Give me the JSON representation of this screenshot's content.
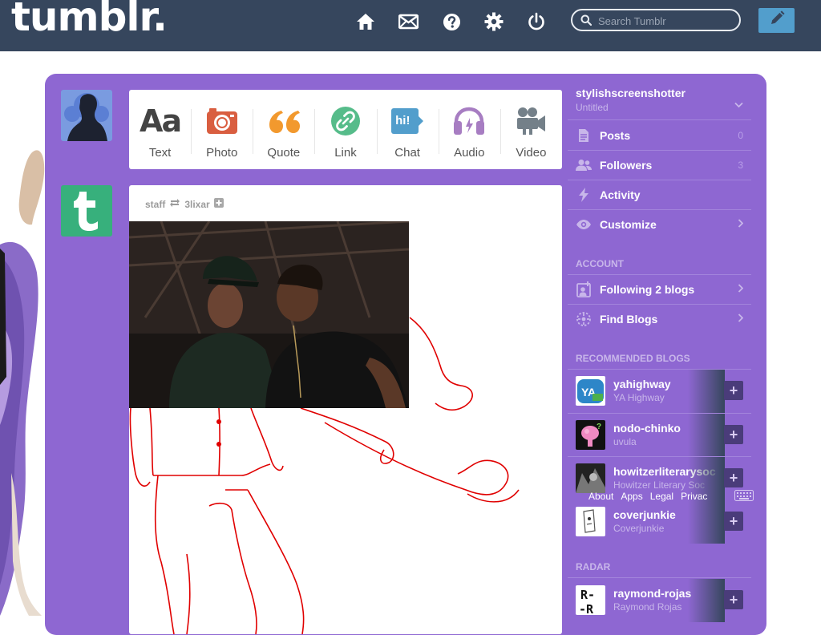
{
  "header": {
    "logo": "tumblr.",
    "search_placeholder": "Search Tumblr",
    "nav": [
      "home-icon",
      "mail-icon",
      "help-icon",
      "gear-icon",
      "power-icon"
    ]
  },
  "post_types": [
    {
      "label": "Text",
      "icon": "text-aa-icon",
      "glyph": "Aa",
      "color": "#444444"
    },
    {
      "label": "Photo",
      "icon": "camera-icon",
      "color": "#d95e40"
    },
    {
      "label": "Quote",
      "icon": "quote-icon",
      "glyph": "66",
      "color": "#f2992e"
    },
    {
      "label": "Link",
      "icon": "link-icon",
      "color": "#56bc8a"
    },
    {
      "label": "Chat",
      "icon": "chat-icon",
      "glyph": "hi!",
      "color": "#529ecc"
    },
    {
      "label": "Audio",
      "icon": "headphones-icon",
      "color": "#a77dc2"
    },
    {
      "label": "Video",
      "icon": "video-camera-icon",
      "color": "#748089"
    }
  ],
  "post": {
    "author": "staff",
    "reblogged_from": "3lixar",
    "photo_colors": {
      "wall": "#2b2320",
      "shirt_left": "#1d2a22",
      "shirt_right": "#121212",
      "skin": "#6b4433"
    },
    "drawing_color": "#e00000"
  },
  "sidebar": {
    "blog_name": "stylishscreenshotter",
    "blog_subtitle": "Untitled",
    "items": [
      {
        "label": "Posts",
        "count": "0",
        "icon": "document-icon"
      },
      {
        "label": "Followers",
        "count": "3",
        "icon": "people-icon"
      },
      {
        "label": "Activity",
        "count": "",
        "icon": "lightning-icon"
      },
      {
        "label": "Customize",
        "count": "",
        "icon": "eye-icon"
      }
    ],
    "account_title": "ACCOUNT",
    "account_items": [
      {
        "label": "Following 2 blogs",
        "icon": "add-person-icon"
      },
      {
        "label": "Find Blogs",
        "icon": "compass-icon"
      }
    ],
    "recommended_title": "RECOMMENDED BLOGS",
    "recommended": [
      {
        "name": "yahighway",
        "subtitle": "YA Highway"
      },
      {
        "name": "nodo-chinko",
        "subtitle": "uvula"
      },
      {
        "name": "howitzerliterarysoc",
        "subtitle": "Howitzer Literary Soc"
      },
      {
        "name": "coverjunkie",
        "subtitle": "Coverjunkie"
      }
    ],
    "radar_title": "RADAR",
    "radar": [
      {
        "name": "raymond-rojas",
        "subtitle": "Raymond Rojas"
      }
    ],
    "footer_links": [
      "About",
      "Apps",
      "Legal",
      "Privac"
    ]
  },
  "colors": {
    "header_bg": "#36465d",
    "panel": "#8e67d2",
    "compose": "#529ecc"
  }
}
